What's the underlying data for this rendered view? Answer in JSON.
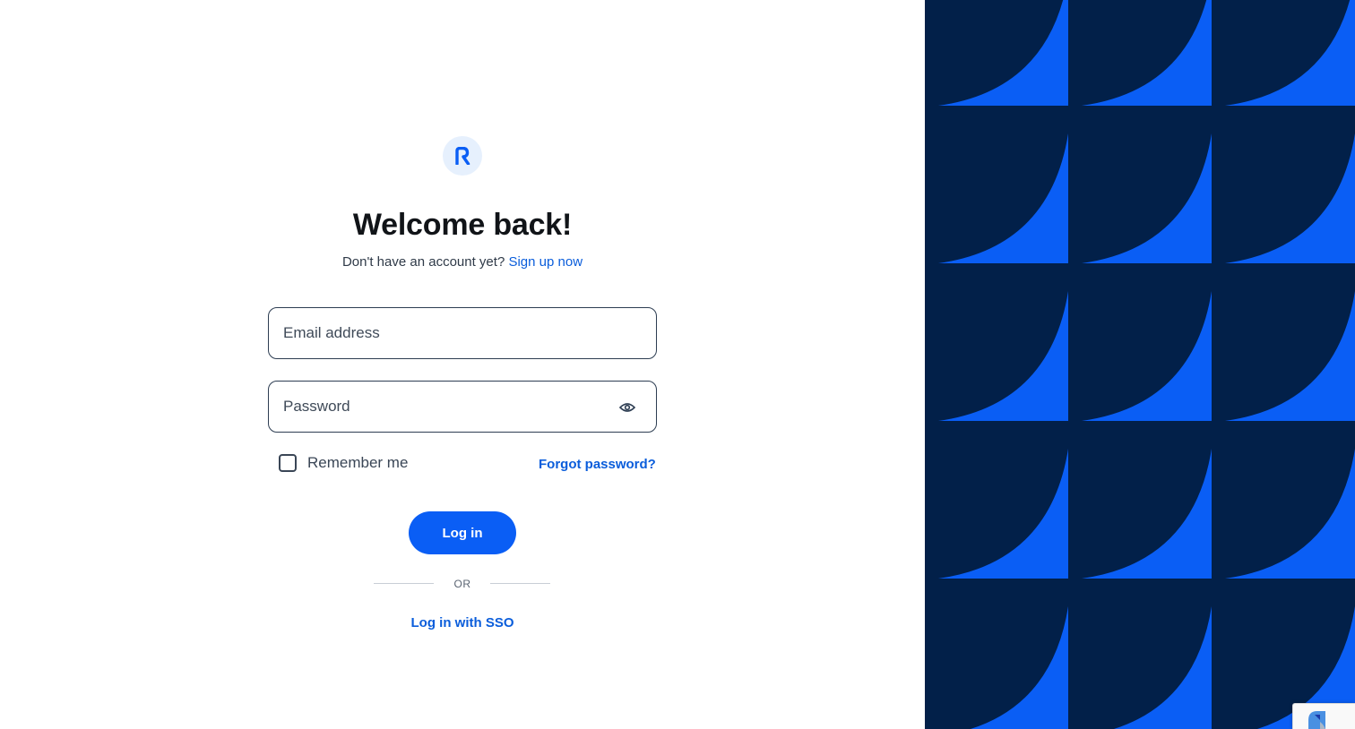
{
  "brand": {
    "logo_icon": "brand-r-logo-icon",
    "accent": "#0a5ef5",
    "link_color": "#0a5ddb",
    "panel_color": "#022049"
  },
  "heading": "Welcome back!",
  "signup": {
    "prompt": "Don't have an account yet?",
    "link": "Sign up now"
  },
  "email": {
    "placeholder": "Email address",
    "value": ""
  },
  "password": {
    "placeholder": "Password",
    "value": "",
    "toggle_icon": "eye-icon"
  },
  "remember": {
    "label": "Remember me",
    "checked": false
  },
  "forgot_link": "Forgot password?",
  "login_button": "Log in",
  "divider_text": "OR",
  "sso_link": "Log in with SSO",
  "recaptcha": {
    "icon": "recaptcha-logo-icon"
  }
}
